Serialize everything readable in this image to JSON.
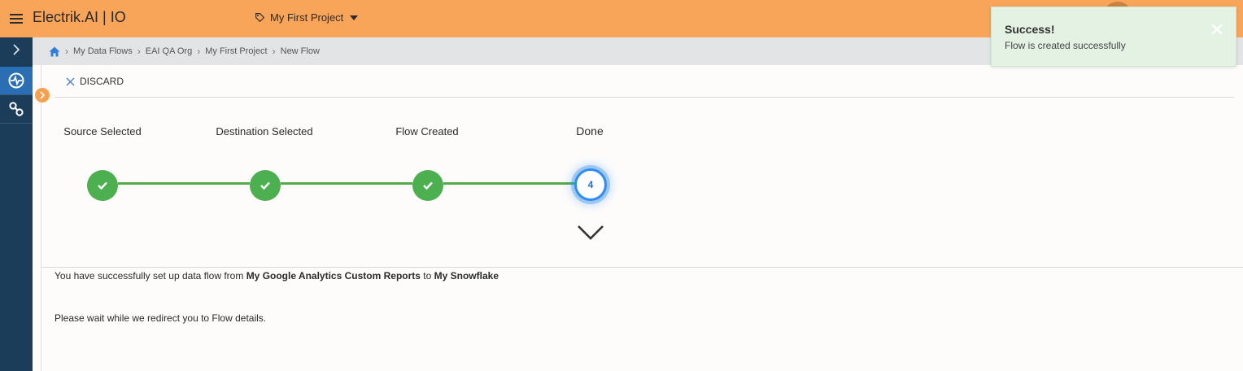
{
  "header": {
    "app_title": "Electrik.AI | IO",
    "project_name": "My First Project",
    "brand_color": "#f8a459"
  },
  "sidebar": {
    "items": [
      {
        "icon": "flow-icon",
        "active": true
      },
      {
        "icon": "link-icon",
        "active": false
      }
    ]
  },
  "breadcrumb": {
    "items": [
      "My Data Flows",
      "EAI QA Org",
      "My First Project",
      "New Flow"
    ]
  },
  "toolbar": {
    "discard_label": "DISCARD"
  },
  "stepper": {
    "steps": [
      {
        "label": "Source Selected",
        "status": "complete"
      },
      {
        "label": "Destination Selected",
        "status": "complete"
      },
      {
        "label": "Flow Created",
        "status": "complete"
      },
      {
        "label": "Done",
        "status": "current",
        "number": "4"
      }
    ],
    "complete_color": "#4caf50",
    "current_color": "#2f8cf0"
  },
  "messages": {
    "success_prefix": "You have successfully set up data flow from ",
    "source_name": "My Google Analytics Custom Reports",
    "connector_word": " to ",
    "destination_name": "My Snowflake",
    "redirect": "Please wait while we redirect you to Flow details."
  },
  "toast": {
    "title": "Success!",
    "message": "Flow is created successfully"
  }
}
